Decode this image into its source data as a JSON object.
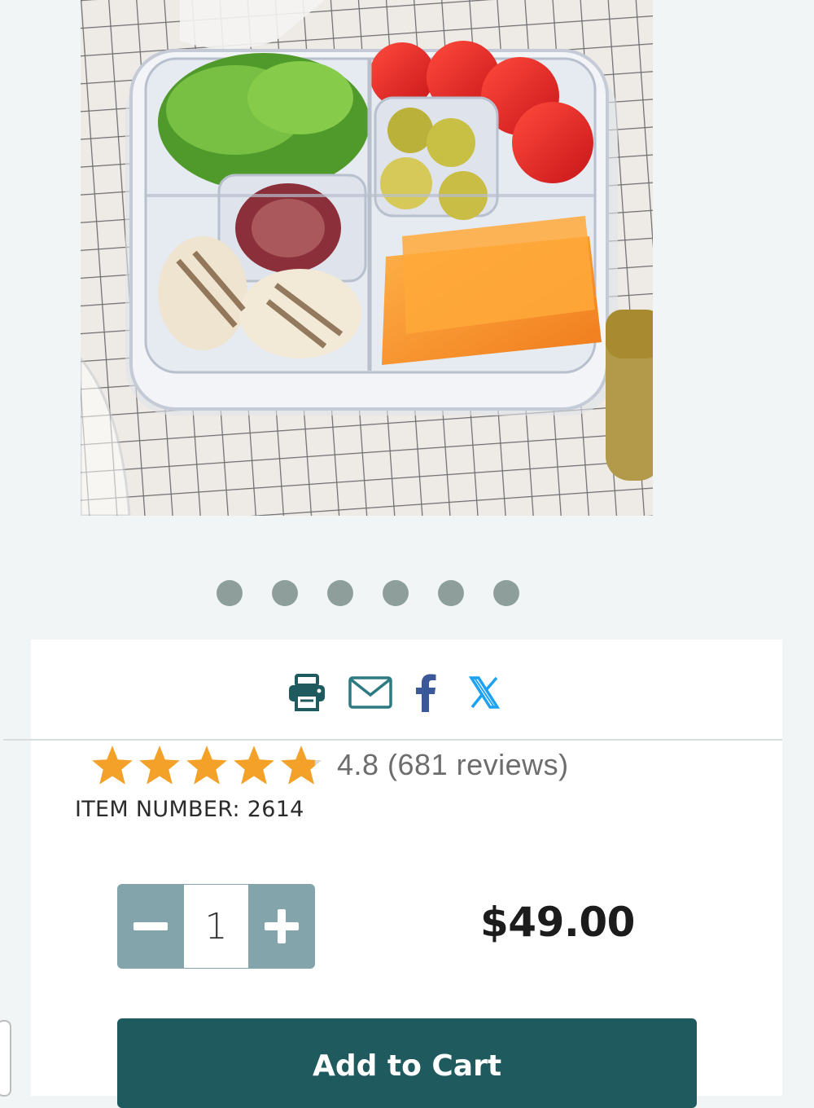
{
  "product_image": {
    "alt": "Clear divided serving tray with lettuce, tomatoes, pickles, onions and cheese"
  },
  "carousel": {
    "dots": [
      "slide-1",
      "slide-2",
      "slide-3",
      "slide-4",
      "slide-5",
      "slide-6"
    ]
  },
  "share": {
    "icons": [
      "print-icon",
      "email-icon",
      "facebook-icon",
      "x-icon"
    ]
  },
  "rating": {
    "value": 4.8,
    "text": "4.8 (681 reviews)",
    "stars_color": "#f4a12a"
  },
  "item_number": "ITEM NUMBER: 2614",
  "quantity": {
    "value": "1"
  },
  "price": "$49.00",
  "add_to_cart_label": "Add to Cart",
  "colors": {
    "brand_teal": "#1e5a5e",
    "stepper": "#82a4aa",
    "dot": "#8d9e9b",
    "background": "#f1f5f5"
  }
}
